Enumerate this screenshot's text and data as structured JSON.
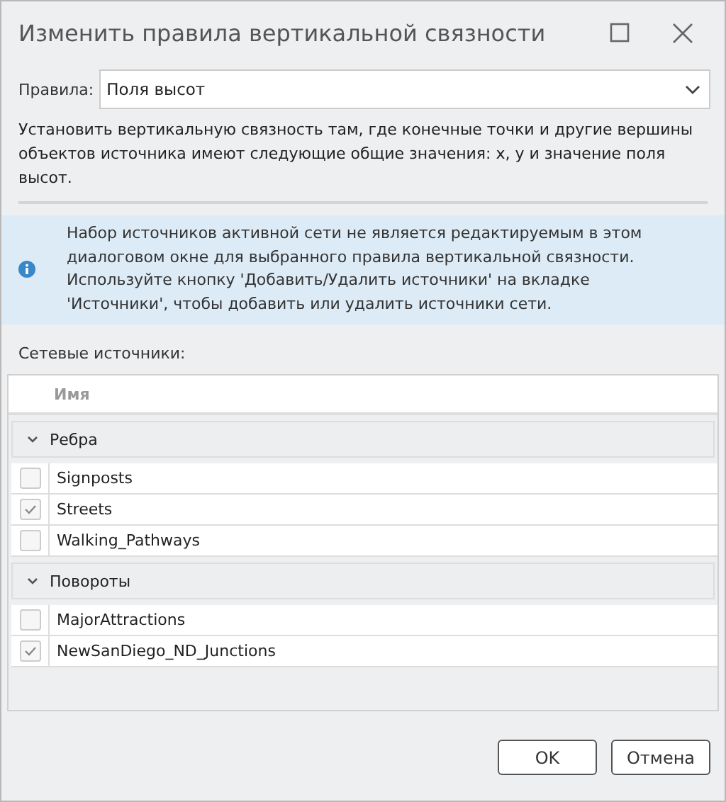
{
  "window": {
    "title": "Изменить правила вертикальной связности"
  },
  "rules": {
    "label": "Правила:",
    "value": "Поля высот"
  },
  "description": "Установить вертикальную связность там, где конечные точки и другие вершины объектов источника имеют следующие общие значения: x, y и значение поля высот.",
  "info": "Набор источников активной сети не является редактируемым в этом диалоговом окне для выбранного правила вертикальной связности. Используйте кнопку 'Добавить/Удалить источники' на вкладке 'Источники', чтобы добавить или удалить источники сети.",
  "sources_label": "Сетевые источники:",
  "table": {
    "column": "Имя",
    "groups": [
      {
        "name": "Ребра",
        "expanded": true,
        "children": [
          {
            "name": "Signposts",
            "checked": false
          },
          {
            "name": "Streets",
            "checked": true
          },
          {
            "name": "Walking_Pathways",
            "checked": false
          }
        ]
      },
      {
        "name": "Повороты",
        "expanded": true,
        "children": [
          {
            "name": "MajorAttractions",
            "checked": false
          },
          {
            "name": "NewSanDiego_ND_Junctions",
            "checked": true
          }
        ]
      }
    ]
  },
  "buttons": [
    "OK",
    "Отмена"
  ]
}
